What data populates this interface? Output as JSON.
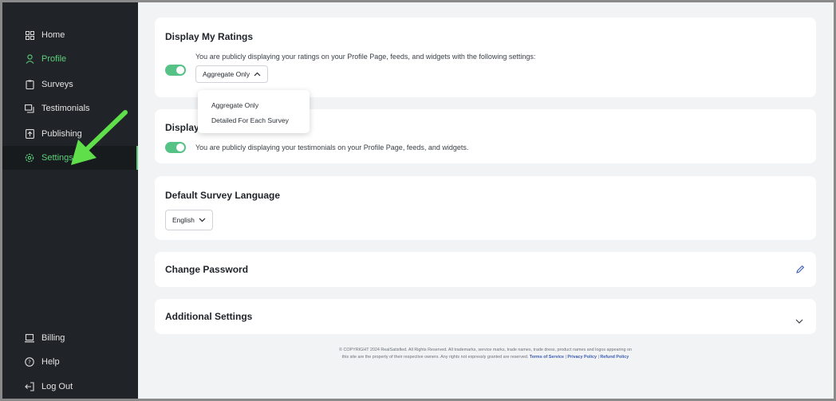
{
  "sidebar": {
    "items": [
      {
        "label": "Home",
        "icon": "grid-icon"
      },
      {
        "label": "Profile",
        "icon": "user-icon"
      },
      {
        "label": "Surveys",
        "icon": "clipboard-icon"
      },
      {
        "label": "Testimonials",
        "icon": "message-icon"
      },
      {
        "label": "Publishing",
        "icon": "publish-icon"
      },
      {
        "label": "Settings",
        "icon": "gear-icon"
      }
    ],
    "bottom_items": [
      {
        "label": "Billing",
        "icon": "laptop-icon"
      },
      {
        "label": "Help",
        "icon": "help-icon"
      },
      {
        "label": "Log Out",
        "icon": "logout-icon"
      }
    ]
  },
  "ratings": {
    "title": "Display My Ratings",
    "description": "You are publicly displaying your ratings on your Profile Page, feeds, and widgets with the following settings:",
    "toggle_on": true,
    "select_value": "Aggregate Only",
    "options": [
      "Aggregate Only",
      "Detailed For Each Survey"
    ]
  },
  "testimonials": {
    "title": "Display",
    "description": "You are publicly displaying your testimonials on your Profile Page, feeds, and widgets.",
    "toggle_on": true
  },
  "language": {
    "title": "Default Survey Language",
    "select_value": "English"
  },
  "password": {
    "title": "Change Password"
  },
  "additional": {
    "title": "Additional Settings"
  },
  "footer": {
    "line1": "© COPYRIGHT 2024 RealSatisfied. All Rights Reserved. All trademarks, service marks, trade names, trade dress, product names and logos appearing on",
    "line2": "this site are the property of their respective owners. Any rights not expressly granted are reserved.",
    "terms": "Terms of Service",
    "sep": "|",
    "privacy": "Privacy Policy",
    "refund": "Refund Policy"
  },
  "colors": {
    "accent": "#5cd07b",
    "toggle": "#57c285",
    "sidebar_bg": "#202428",
    "arrow": "#5fe04a"
  }
}
